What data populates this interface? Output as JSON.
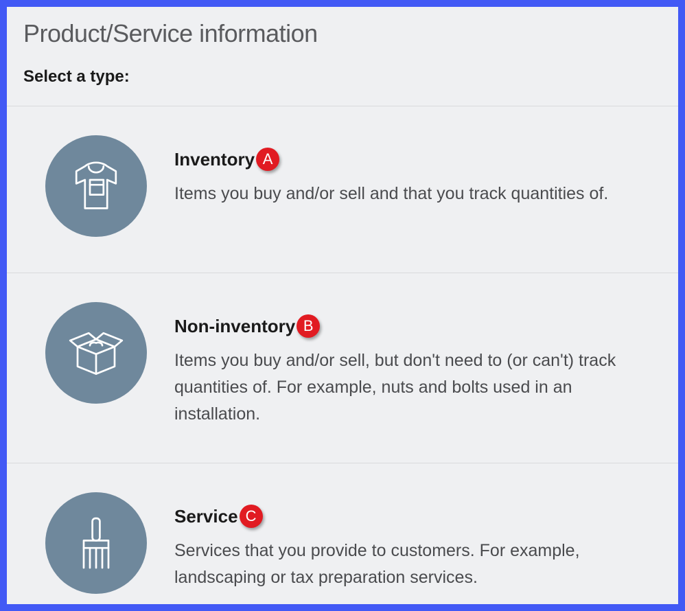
{
  "header": {
    "title": "Product/Service information",
    "subtitle": "Select a type:"
  },
  "types": [
    {
      "title": "Inventory",
      "badge": "A",
      "description": "Items you buy and/or sell and that you track quantities of."
    },
    {
      "title": "Non-inventory",
      "badge": "B",
      "description": "Items you buy and/or sell, but don't need to (or can't) track quantities of. For example, nuts and bolts used in an installation."
    },
    {
      "title": "Service",
      "badge": "C",
      "description": "Services that you provide to customers. For example, landscaping or tax preparation services."
    }
  ]
}
